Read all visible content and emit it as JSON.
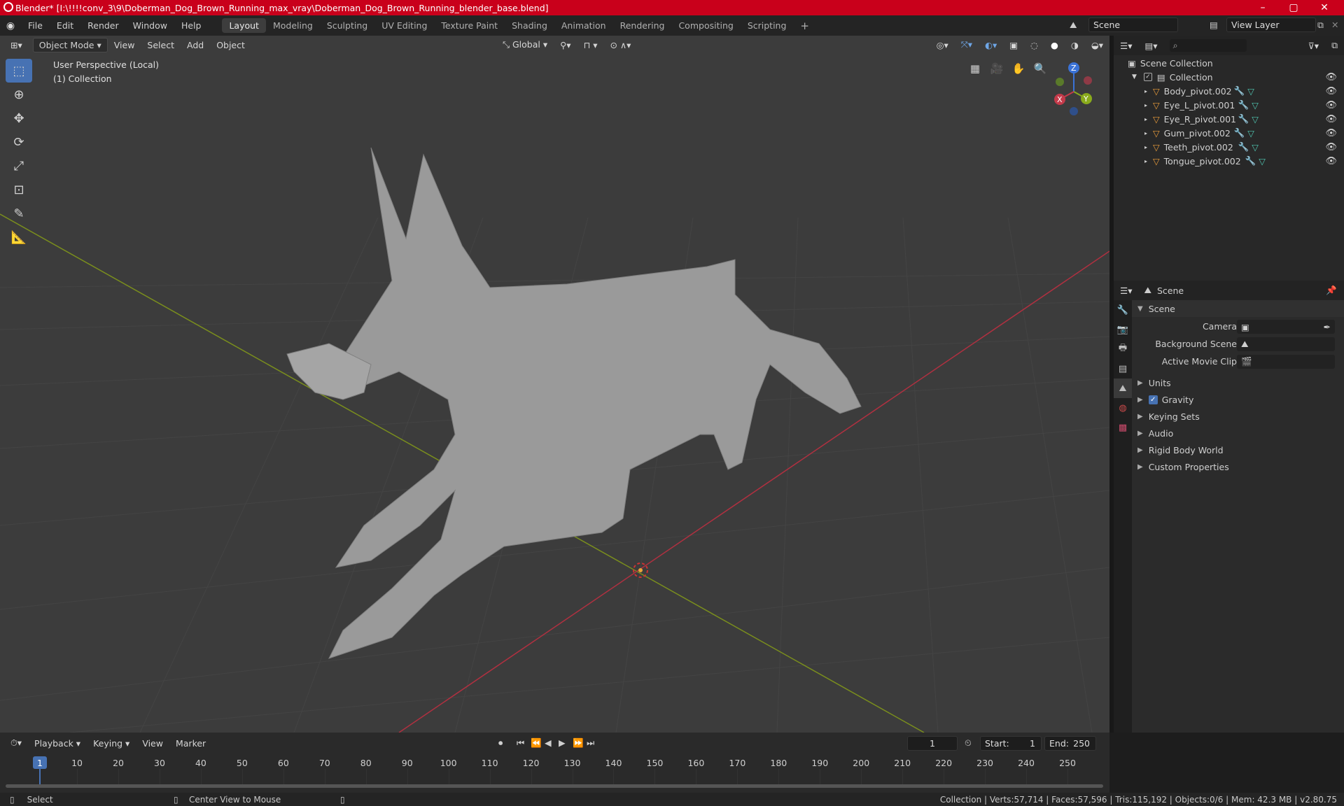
{
  "window": {
    "title": "Blender* [I:\\!!!!conv_3\\9\\Doberman_Dog_Brown_Running_max_vray\\Doberman_Dog_Brown_Running_blender_base.blend]",
    "controls": [
      "–",
      "▢",
      "✕"
    ]
  },
  "menu": [
    "File",
    "Edit",
    "Render",
    "Window",
    "Help"
  ],
  "workspaces": [
    "Layout",
    "Modeling",
    "Sculpting",
    "UV Editing",
    "Texture Paint",
    "Shading",
    "Animation",
    "Rendering",
    "Compositing",
    "Scripting"
  ],
  "scene_field": "Scene",
  "view_layer_field": "View Layer",
  "viewport": {
    "mode": "Object Mode",
    "menus": [
      "View",
      "Select",
      "Add",
      "Object"
    ],
    "transform_orientation": "Global",
    "overlay_text_line1": "User Perspective (Local)",
    "overlay_text_line2": "(1) Collection",
    "gizmo_axes": [
      "X",
      "Y",
      "Z"
    ],
    "colors": {
      "x_axis": "#c43a4a",
      "y_axis": "#8aab1c",
      "z_axis": "#3a72d6",
      "active_tool": "#4772b3"
    }
  },
  "outliner": {
    "root": "Scene Collection",
    "collection": "Collection",
    "objects": [
      "Body_pivot.002",
      "Eye_L_pivot.001",
      "Eye_R_pivot.001",
      "Gum_pivot.002",
      "Teeth_pivot.002",
      "Tongue_pivot.002"
    ]
  },
  "properties": {
    "context": "Scene",
    "panel": "Scene",
    "fields": [
      {
        "label": "Camera"
      },
      {
        "label": "Background Scene"
      },
      {
        "label": "Active Movie Clip"
      }
    ],
    "sections": [
      "Units",
      "Gravity",
      "Keying Sets",
      "Audio",
      "Rigid Body World",
      "Custom Properties"
    ],
    "gravity_checked": true
  },
  "timeline": {
    "menus": [
      "Playback",
      "Keying",
      "View",
      "Marker"
    ],
    "current_frame": "1",
    "start_label": "Start:",
    "start": "1",
    "end_label": "End:",
    "end": "250",
    "ticks": [
      "1",
      "10",
      "20",
      "30",
      "40",
      "50",
      "60",
      "70",
      "80",
      "90",
      "100",
      "110",
      "120",
      "130",
      "140",
      "150",
      "160",
      "170",
      "180",
      "190",
      "200",
      "210",
      "220",
      "230",
      "240",
      "250"
    ]
  },
  "statusbar": {
    "left": "Select",
    "middle": "Center View to Mouse",
    "right": "Collection | Verts:57,714 | Faces:57,596 | Tris:115,192 | Objects:0/6 | Mem: 42.3 MB | v2.80.75"
  }
}
